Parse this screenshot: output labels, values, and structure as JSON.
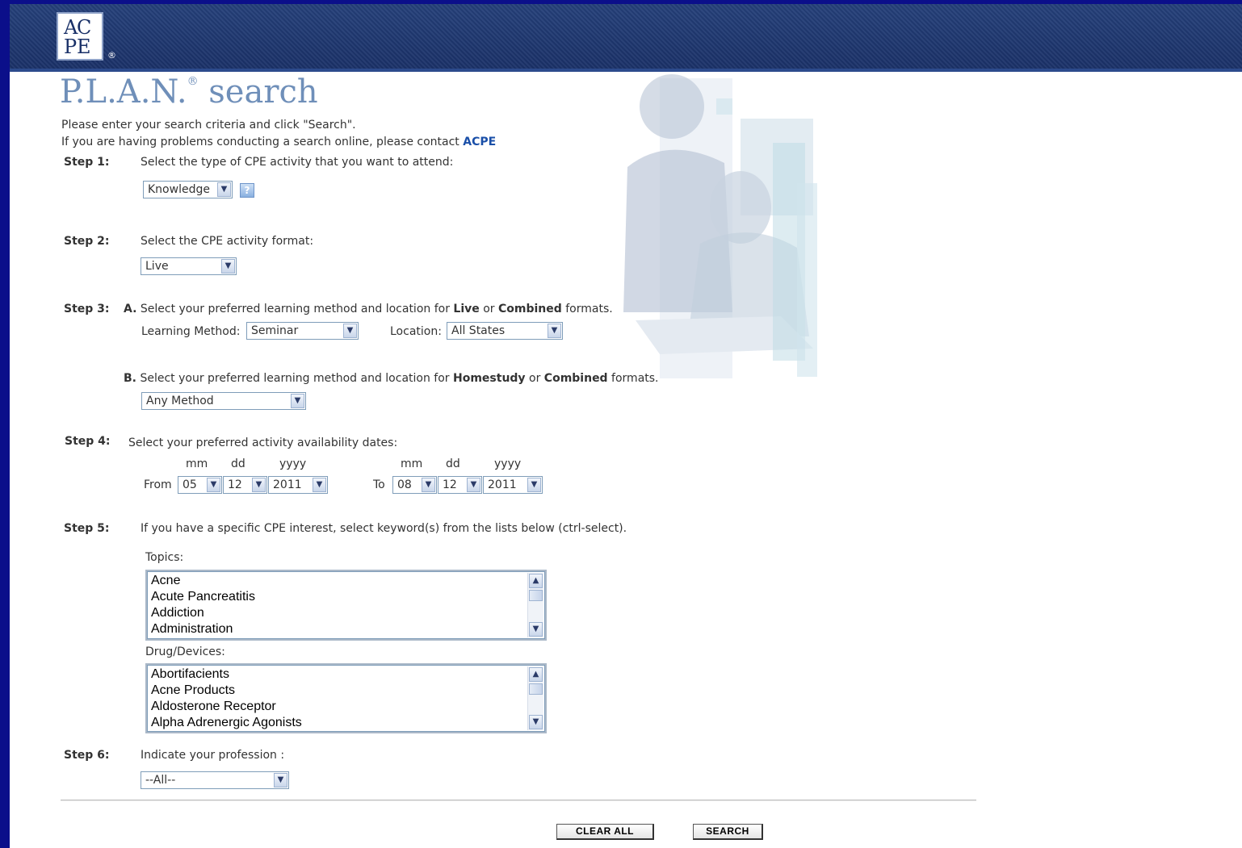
{
  "header": {
    "logo_text": "ACPE",
    "logo_mark": "®"
  },
  "page": {
    "title": "P.L.A.N.",
    "title_mark": "®",
    "title_word": "search",
    "intro_line1": "Please enter your search criteria and click \"Search\".",
    "intro_line2": "If you are having problems conducting a search online, please contact",
    "contact_link": "ACPE"
  },
  "step1": {
    "label": "Step 1:",
    "text": "Select the type of CPE activity that you want to attend:",
    "select_value": "Knowledge",
    "help_icon": "?"
  },
  "step2": {
    "label": "Step 2:",
    "text": "Select the CPE activity format:",
    "select_value": "Live"
  },
  "step3": {
    "label": "Step 3:",
    "a_marker": "A.",
    "a_text_pre": "Select your preferred learning method and location for",
    "a_live": "Live",
    "a_or": "or",
    "a_combined": "Combined",
    "a_suffix": "formats.",
    "method_label": "Learning Method:",
    "method_value": "Seminar",
    "location_label": "Location:",
    "location_value": "All States",
    "b_marker": "B.",
    "b_text_pre": "Select your preferred learning method and location for",
    "b_homestudy": "Homestudy",
    "b_or": "or",
    "b_combined": "Combined",
    "b_suffix": "formats.",
    "b_method_value": "Any Method"
  },
  "step4": {
    "label": "Step 4:",
    "text": "Select your preferred activity availability dates:",
    "mm": "mm",
    "dd": "dd",
    "yyyy": "yyyy",
    "from_label": "From",
    "from_mm": "05",
    "from_dd": "12",
    "from_yyyy": "2011",
    "to_label": "To",
    "to_mm": "08",
    "to_dd": "12",
    "to_yyyy": "2011"
  },
  "step5": {
    "label": "Step 5:",
    "text": "If you have a specific CPE interest, select keyword(s) from the lists below (ctrl-select).",
    "topics_label": "Topics:",
    "topics": [
      "Acne",
      "Acute Pancreatitis",
      "Addiction",
      "Administration"
    ],
    "drugs_label": "Drug/Devices:",
    "drugs": [
      "Abortifacients",
      "Acne Products",
      "Aldosterone Receptor",
      "Alpha Adrenergic Agonists"
    ]
  },
  "step6": {
    "label": "Step 6:",
    "text": "Indicate your profession :",
    "select_value": "--All--"
  },
  "actions": {
    "clear_label": "CLEAR ALL",
    "search_label": "SEARCH"
  }
}
